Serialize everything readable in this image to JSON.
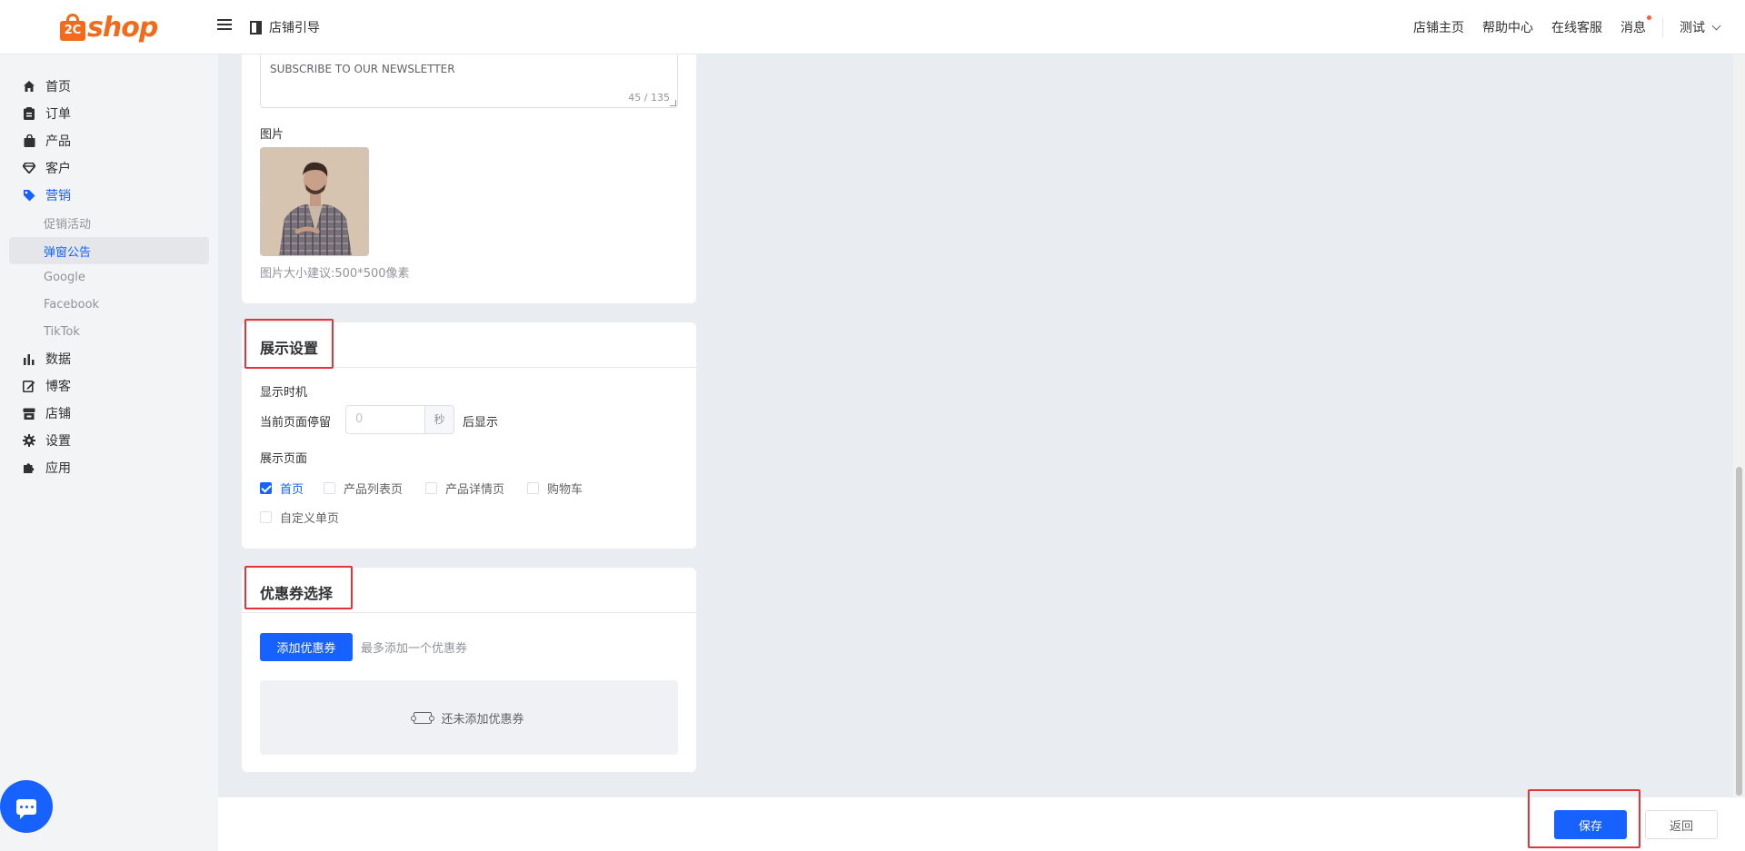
{
  "header": {
    "logo_text": "shop",
    "logo_badge": "2C",
    "guide_label": "店铺引导",
    "nav": [
      "店铺主页",
      "帮助中心",
      "在线客服",
      "消息"
    ],
    "user": "测试"
  },
  "sidebar": {
    "items": [
      {
        "label": "首页",
        "icon": "home-icon"
      },
      {
        "label": "订单",
        "icon": "clipboard-icon"
      },
      {
        "label": "产品",
        "icon": "bag-icon"
      },
      {
        "label": "客户",
        "icon": "diamond-icon"
      },
      {
        "label": "营销",
        "icon": "tag-icon"
      },
      {
        "label": "数据",
        "icon": "bar-chart-icon"
      },
      {
        "label": "博客",
        "icon": "edit-icon"
      },
      {
        "label": "店铺",
        "icon": "store-icon"
      },
      {
        "label": "设置",
        "icon": "gear-icon"
      },
      {
        "label": "应用",
        "icon": "puzzle-icon"
      }
    ],
    "sub_items": [
      "促销活动",
      "弹窗公告",
      "Google",
      "Facebook",
      "TikTok"
    ]
  },
  "content_card": {
    "textarea_line": "SUBSCRIBE TO OUR NEWSLETTER",
    "textarea_counter": "45 / 135",
    "image_label": "图片",
    "image_hint": "图片大小建议:500*500像素"
  },
  "display_card": {
    "title": "展示设置",
    "timing_label": "显示时机",
    "stay_prefix": "当前页面停留",
    "stay_value": "0",
    "stay_unit": "秒",
    "stay_suffix": "后显示",
    "pages_label": "展示页面",
    "pages": [
      {
        "label": "首页",
        "checked": true
      },
      {
        "label": "产品列表页",
        "checked": false
      },
      {
        "label": "产品详情页",
        "checked": false
      },
      {
        "label": "购物车",
        "checked": false
      },
      {
        "label": "自定义单页",
        "checked": false
      }
    ]
  },
  "coupon_card": {
    "title": "优惠券选择",
    "add_button": "添加优惠券",
    "hint": "最多添加一个优惠券",
    "empty_text": "还未添加优惠券"
  },
  "footer": {
    "save": "保存",
    "back": "返回"
  },
  "colors": {
    "primary": "#1661ff",
    "brand": "#f26b1d",
    "highlight": "#e5333a"
  }
}
